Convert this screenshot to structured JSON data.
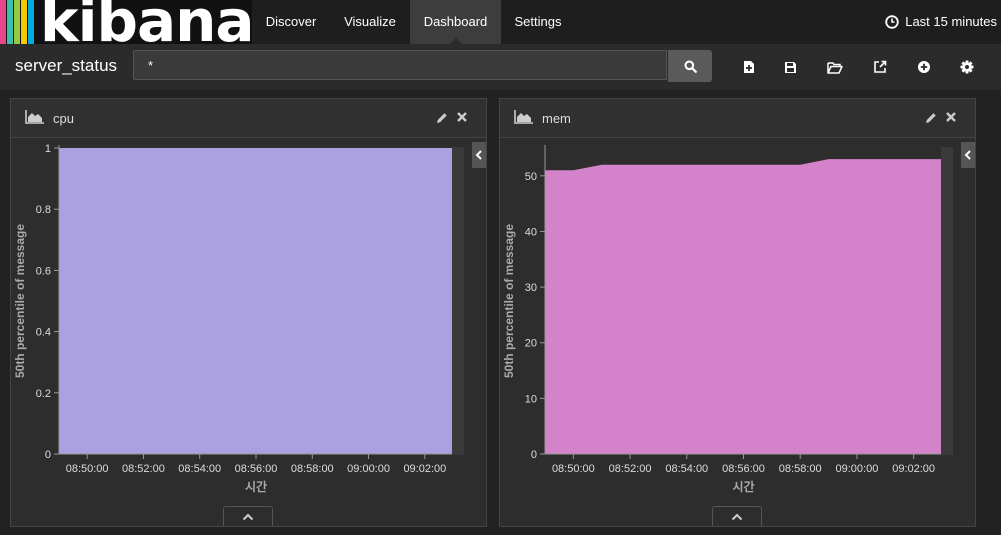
{
  "app": {
    "logo_text": "kibana",
    "logo_colors": [
      "#e8478b",
      "#3ebeb0",
      "#96c93d",
      "#f9c800",
      "#00a9e0"
    ]
  },
  "nav": {
    "items": [
      {
        "label": "Discover",
        "active": false
      },
      {
        "label": "Visualize",
        "active": false
      },
      {
        "label": "Dashboard",
        "active": true
      },
      {
        "label": "Settings",
        "active": false
      }
    ],
    "timepicker_label": "Last 15 minutes",
    "timepicker_icon": "clock-icon"
  },
  "toolbar": {
    "dashboard_title": "server_status",
    "search_value": "*",
    "search_icon": "search-icon",
    "tools": [
      "new-dashboard-icon",
      "save-icon",
      "open-icon",
      "share-icon",
      "add-panel-icon",
      "gear-icon"
    ]
  },
  "panels": [
    {
      "title": "cpu",
      "icon": "area-chart-icon",
      "chart_data": {
        "type": "area",
        "title": "cpu",
        "xlabel": "시간",
        "ylabel": "50th percentile of message",
        "x": [
          "08:49:00",
          "08:50:00",
          "08:51:00",
          "08:52:00",
          "08:53:00",
          "08:54:00",
          "08:55:00",
          "08:56:00",
          "08:57:00",
          "08:58:00",
          "08:59:00",
          "09:00:00",
          "09:01:00",
          "09:02:00",
          "09:03:00"
        ],
        "x_ticks": [
          "08:50:00",
          "08:52:00",
          "08:54:00",
          "08:56:00",
          "08:58:00",
          "09:00:00",
          "09:02:00"
        ],
        "y_ticks": [
          "0",
          "0.2",
          "0.4",
          "0.6",
          "0.8",
          "1"
        ],
        "ylim": [
          0,
          1
        ],
        "series": [
          {
            "color": "#aba0e0",
            "values": [
              1,
              1,
              1,
              1,
              1,
              1,
              1,
              1,
              1,
              1,
              1,
              1,
              1,
              1,
              1
            ]
          }
        ]
      }
    },
    {
      "title": "mem",
      "icon": "area-chart-icon",
      "chart_data": {
        "type": "area",
        "title": "mem",
        "xlabel": "시간",
        "ylabel": "50th percentile of message",
        "x": [
          "08:49:00",
          "08:50:00",
          "08:51:00",
          "08:52:00",
          "08:53:00",
          "08:54:00",
          "08:55:00",
          "08:56:00",
          "08:57:00",
          "08:58:00",
          "08:59:00",
          "09:00:00",
          "09:01:00",
          "09:02:00",
          "09:03:00"
        ],
        "x_ticks": [
          "08:50:00",
          "08:52:00",
          "08:54:00",
          "08:56:00",
          "08:58:00",
          "09:00:00",
          "09:02:00"
        ],
        "y_ticks": [
          "0",
          "10",
          "20",
          "30",
          "40",
          "50"
        ],
        "ylim": [
          0,
          55
        ],
        "series": [
          {
            "color": "#d483cb",
            "values": [
              51,
              51,
              52,
              52,
              52,
              52,
              52,
              52,
              52,
              52,
              53,
              53,
              53,
              53,
              53
            ]
          }
        ]
      }
    }
  ]
}
